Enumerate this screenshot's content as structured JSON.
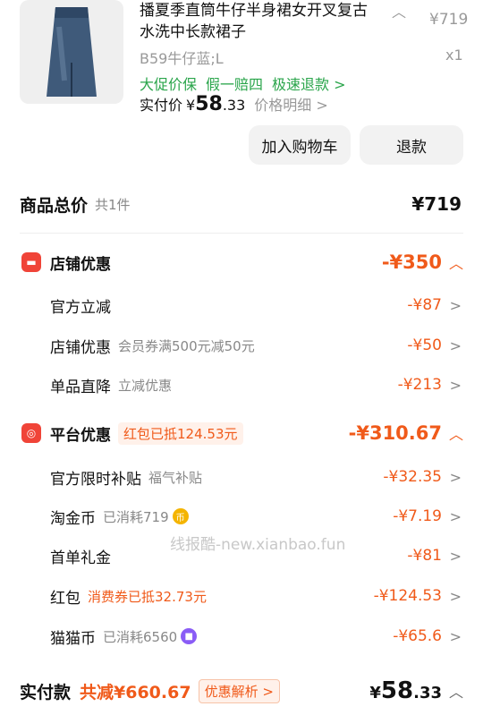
{
  "product": {
    "title": "播夏季直筒牛仔半身裙女开叉复古水洗中长款裙子",
    "price": "¥719",
    "sku": "B59牛仔蓝;L",
    "qty": "x1",
    "tags": [
      "大促价保",
      "假一赔四",
      "极速退款 >"
    ],
    "paid_label": "实付价",
    "paid_currency": "¥",
    "paid_int": "58",
    "paid_dec": ".33",
    "detail_link": "价格明细 >"
  },
  "buttons": {
    "cart": "加入购物车",
    "refund": "退款"
  },
  "total": {
    "label": "商品总价",
    "count": "共1件",
    "amount": "¥719"
  },
  "shop": {
    "title": "店铺优惠",
    "amount": "-¥350",
    "items": [
      {
        "label": "官方立减",
        "sub": "",
        "amount": "-¥87"
      },
      {
        "label": "店铺优惠",
        "sub": "会员券满500元减50元",
        "amount": "-¥50"
      },
      {
        "label": "单品直降",
        "sub": "立减优惠",
        "amount": "-¥213"
      }
    ]
  },
  "platform": {
    "title": "平台优惠",
    "chip": "红包已抵124.53元",
    "amount": "-¥310.67",
    "items": [
      {
        "label": "官方限时补贴",
        "sub": "福气补贴",
        "amount": "-¥32.35"
      },
      {
        "label": "淘金币",
        "sub": "已消耗719",
        "amount": "-¥7.19"
      },
      {
        "label": "首单礼金",
        "sub": "",
        "amount": "-¥81"
      },
      {
        "label": "红包",
        "sub": "消费券已抵32.73元",
        "amount": "-¥124.53"
      },
      {
        "label": "猫猫币",
        "sub": "已消耗6560",
        "amount": "-¥65.6"
      }
    ]
  },
  "watermark": "线报酷-new.xianbao.fun",
  "footer": {
    "label": "实付款",
    "saved": "共减¥660.67",
    "analysis": "优惠解析 >",
    "currency": "¥",
    "int": "58",
    "dec": ".33"
  },
  "colors": {
    "accent": "#f05a1a",
    "green": "#2aa54b",
    "icon_red": "#f04438"
  }
}
